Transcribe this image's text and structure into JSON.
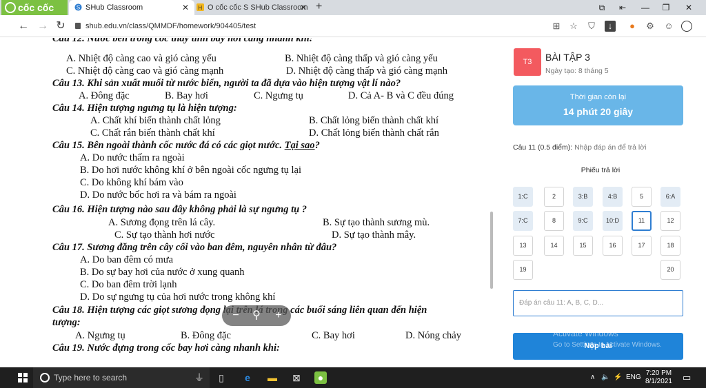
{
  "browser": {
    "brand": "cốc cốc",
    "tabs": [
      {
        "title": "SHub Classroom",
        "active": true
      },
      {
        "title": "O cốc cốc S SHub Classroom",
        "active": false
      }
    ],
    "url": "shub.edu.vn/class/QMMDF/homework/904405/test"
  },
  "document": {
    "top_partial": "Câu 12. Nước bên trong cốc thấy tinh bay hơi càng nhanh khi:",
    "lines": [
      {
        "a": "A. Nhiệt độ càng cao và gió càng yếu",
        "b": "B. Nhiệt độ càng thấp và gió càng yếu"
      },
      {
        "a": "C. Nhiệt độ càng cao và gió càng mạnh",
        "b": "D. Nhiệt độ càng thấp và gió càng mạnh"
      }
    ],
    "q13": "Câu 13. Khi sản xuất muối từ nước biển, người ta đã dựa vào hiện tượng vật lí nào?",
    "q13_opts": [
      "A. Đông đặc",
      "B. Bay hơi",
      "C. Ngưng tụ",
      "D. Cả A- B và C đều đúng"
    ],
    "q14": "Câu 14. Hiện tượng ngưng tụ là hiện tượng:",
    "q14_opts": [
      "A. Chất khí biến thành chất lỏng",
      "B. Chất lỏng biến thành chất khí",
      "C. Chất rắn biến thành chất khí",
      "D. Chất lỏng biến thành chất rắn"
    ],
    "q15_pre": "Câu 15. Bên ngoài thành cốc nước đá có các giọt nước. ",
    "q15_u": "Tại sao",
    "q15_post": "?",
    "q15_opts": [
      "A. Do nước thấm ra ngoài",
      "B. Do hơi nước không khí ở bên ngoài cốc ngưng tụ lại",
      "C.  Do không khí bám vào",
      "D. Do nước bốc hơi ra và bám ra ngoài"
    ],
    "q16": "Câu 16. Hiện tượng nào sau đây không phải là sự ngưng tụ ?",
    "q16_opts": [
      "A. Sương đọng trên lá cây.",
      "B.  Sự tạo thành sương mù.",
      "C.   Sự tạo thành hơi nước",
      "D.  Sự tạo thành mây."
    ],
    "q17": "Câu 17. Sương đăng trên cây cối vào ban đêm, nguyên nhân từ đâu?",
    "q17_opts": [
      "A.  Do ban đêm có mưa",
      "B. Do sự bay hơi của nước ở xung quanh",
      "C. Do ban đêm trời lạnh",
      "D. Do sự ngưng tụ của hơi nước trong không khí"
    ],
    "q18": "Câu 18. Hiện tượng các giọt sương đọng lại trên lá trong các buổi sáng liên quan đến hiện",
    "q18_cont": "tượng:",
    "q18_opts": [
      "A. Ngưng tụ",
      "B.  Đông đặc",
      "C. Bay hơi",
      "D. Nóng chảy"
    ],
    "q19": "Câu 19. Nước đựng trong cốc bay hơi càng nhanh khi:"
  },
  "panel": {
    "badge": "T3",
    "title": "BÀI TẬP 3",
    "created": "Ngày tạo: 8 tháng 5",
    "timer_label": "Thời gian còn lại",
    "timer_value": "14 phút 20 giây",
    "prompt_q": "Câu 11 (0.5 điểm):",
    "prompt_hint": " Nhập đáp án để trả lời",
    "sheet_title": "Phiếu trả lời",
    "cells": [
      {
        "label": "1:C",
        "state": "done"
      },
      {
        "label": "2",
        "state": "empty"
      },
      {
        "label": "3:B",
        "state": "done"
      },
      {
        "label": "4:B",
        "state": "done"
      },
      {
        "label": "5",
        "state": "empty"
      },
      {
        "label": "6:A",
        "state": "done"
      },
      {
        "label": "7:C",
        "state": "done"
      },
      {
        "label": "8",
        "state": "empty"
      },
      {
        "label": "9:C",
        "state": "done"
      },
      {
        "label": "10:D",
        "state": "done"
      },
      {
        "label": "11",
        "state": "current"
      },
      {
        "label": "12",
        "state": "empty"
      },
      {
        "label": "13",
        "state": "empty"
      },
      {
        "label": "14",
        "state": "empty"
      },
      {
        "label": "15",
        "state": "empty"
      },
      {
        "label": "16",
        "state": "empty"
      },
      {
        "label": "17",
        "state": "empty"
      },
      {
        "label": "18",
        "state": "empty"
      },
      {
        "label": "19",
        "state": "empty"
      },
      {
        "label": "20",
        "state": "empty"
      }
    ],
    "answer_placeholder": "Đáp án câu 11: A, B, C, D...",
    "submit": "Nộp bài",
    "watermark1": "Activate Windows",
    "watermark2": "Go to Settings to activate Windows."
  },
  "taskbar": {
    "search_placeholder": "Type here to search",
    "lang": "ENG",
    "time": "7:20 PM",
    "date": "8/1/2021"
  }
}
